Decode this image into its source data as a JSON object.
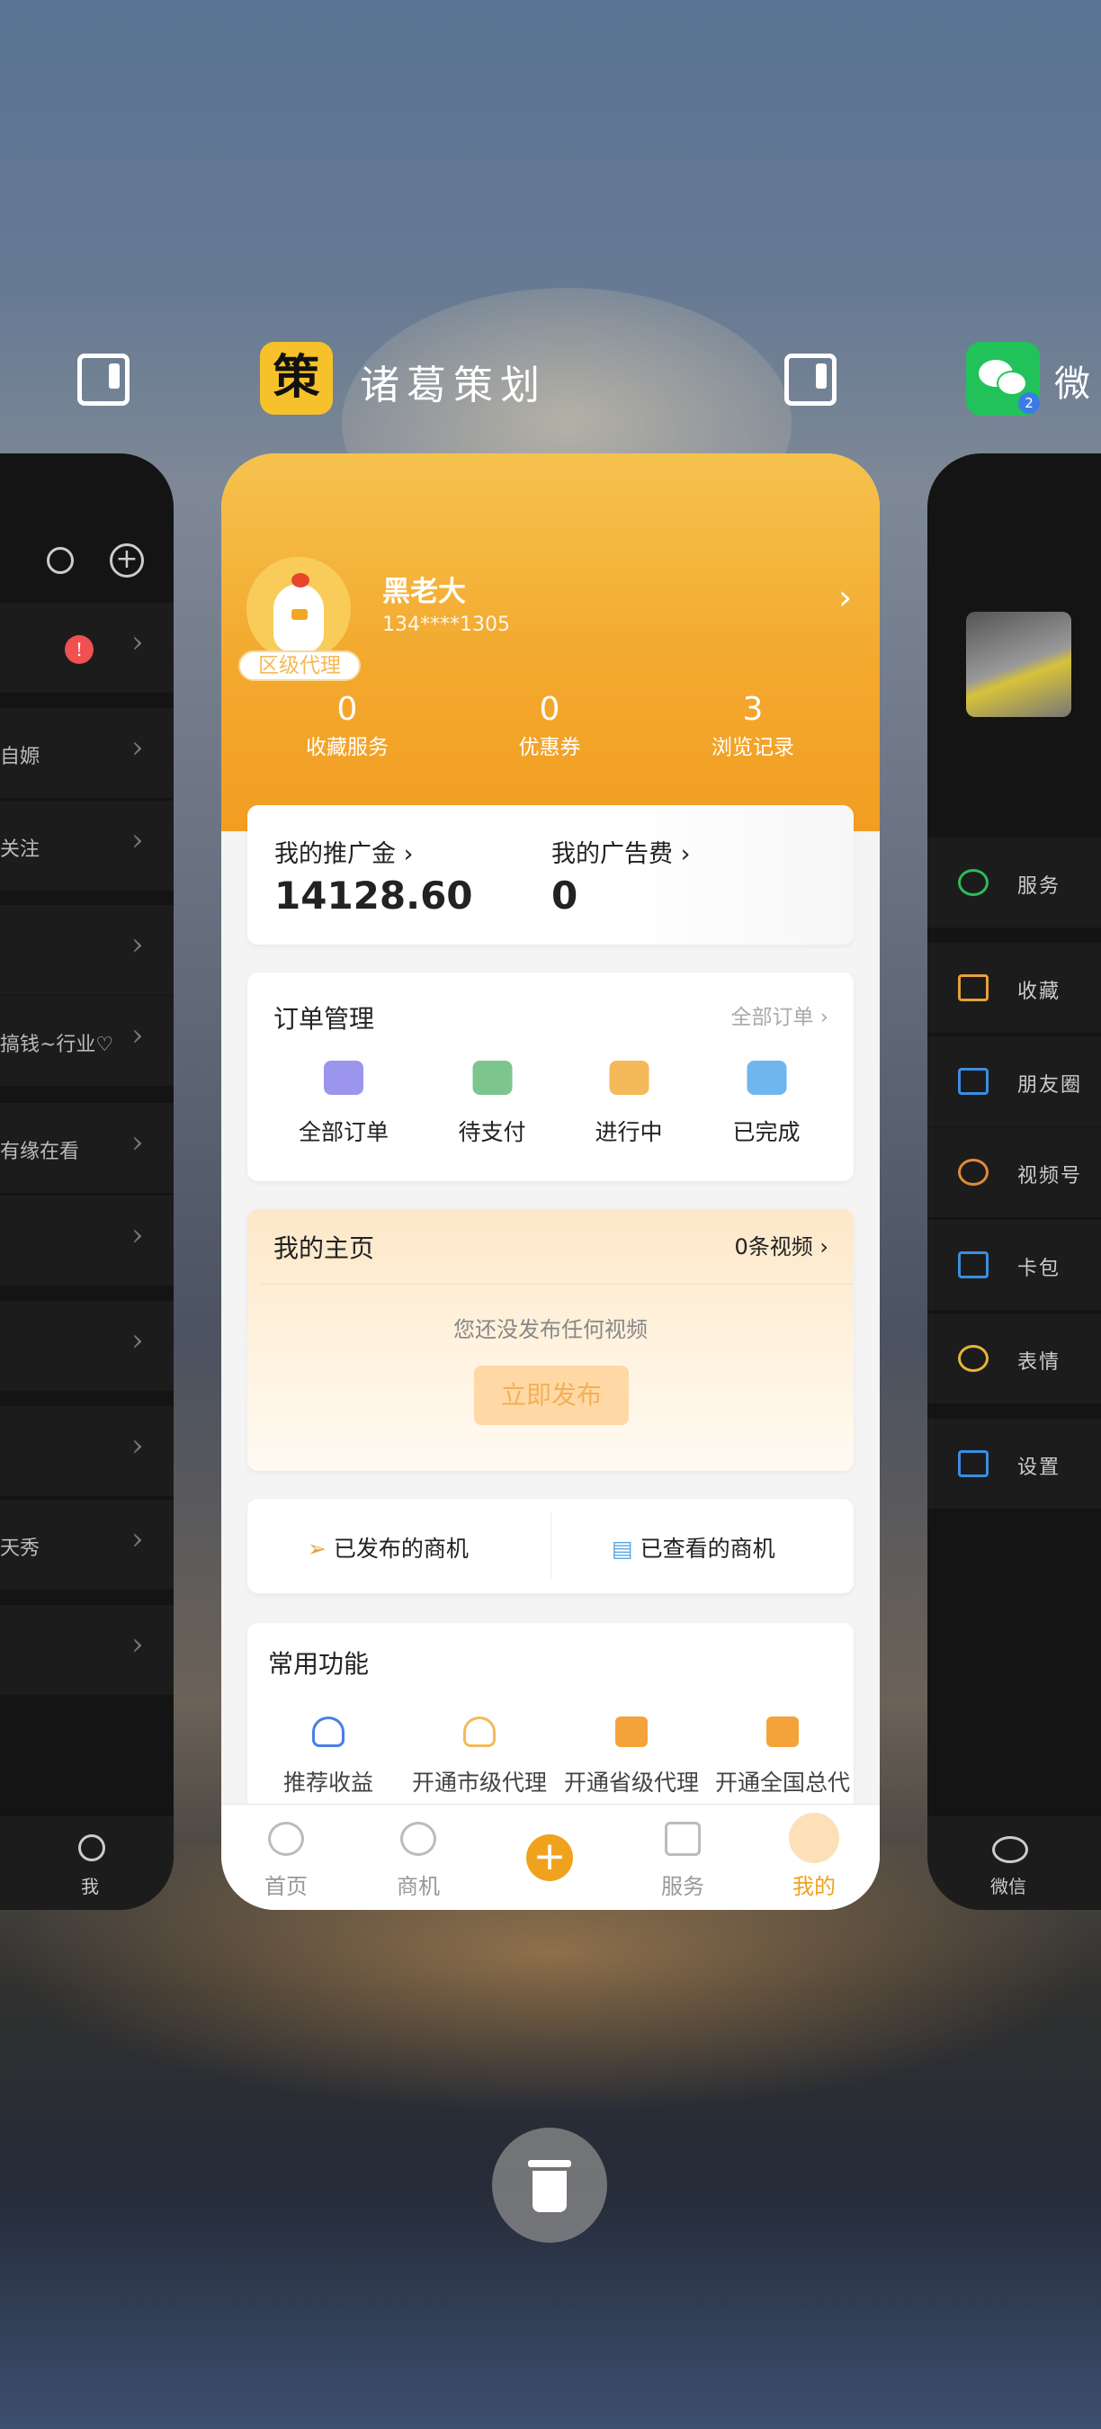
{
  "switcher": {
    "center_app_title": "诸葛策划",
    "center_app_icon_text": "策",
    "right_app_title_partial": "微",
    "right_app_badge": "2"
  },
  "left_app": {
    "rows": [
      {
        "text": "",
        "badge": "!"
      },
      {
        "text": "自嫄"
      },
      {
        "text": "关注"
      },
      {
        "text": ""
      },
      {
        "text": "搞钱~行业♡"
      },
      {
        "text": "有缘在看"
      },
      {
        "text": ""
      },
      {
        "text": ""
      },
      {
        "text": ""
      },
      {
        "text": "天秀"
      },
      {
        "text": ""
      }
    ],
    "tab_label": "我"
  },
  "right_app": {
    "menu": [
      {
        "icon": "service-icon",
        "label": "服务",
        "color": "#2dbb5a"
      },
      {
        "icon": "favorites-cube-icon",
        "label": "收藏",
        "color": "#e5a13a"
      },
      {
        "icon": "moments-image-icon",
        "label": "朋友圈",
        "color": "#3b8ee0"
      },
      {
        "icon": "channels-play-icon",
        "label": "视频号",
        "color": "#e08a3b"
      },
      {
        "icon": "card-wallet-icon",
        "label": "卡包",
        "color": "#3b8ee0"
      },
      {
        "icon": "sticker-smile-icon",
        "label": "表情",
        "color": "#e5b53a"
      },
      {
        "icon": "settings-gear-icon",
        "label": "设置",
        "color": "#3b8ee0"
      }
    ],
    "tab_label": "微信"
  },
  "profile": {
    "name": "黑老大",
    "phone": "134****1305",
    "level_badge": "区级代理",
    "stats": [
      {
        "value": "0",
        "label": "收藏服务"
      },
      {
        "value": "0",
        "label": "优惠券"
      },
      {
        "value": "3",
        "label": "浏览记录"
      }
    ]
  },
  "wallet": {
    "promo_label": "我的推广金",
    "promo_value": "14128.60",
    "ad_label": "我的广告费",
    "ad_value": "0"
  },
  "orders": {
    "title": "订单管理",
    "all_link": "全部订单",
    "items": [
      {
        "label": "全部订单",
        "icon": "wallet-icon",
        "color": "#9b95ee"
      },
      {
        "label": "待支付",
        "icon": "package-icon",
        "color": "#7cc58e"
      },
      {
        "label": "进行中",
        "icon": "delivery-truck-icon",
        "color": "#f4b95a"
      },
      {
        "label": "已完成",
        "icon": "chat-smile-icon",
        "color": "#6fb6ee"
      }
    ]
  },
  "homepage": {
    "title": "我的主页",
    "video_count": "0条视频",
    "empty_text": "您还没发布任何视频",
    "publish_button": "立即发布"
  },
  "business": {
    "published": "已发布的商机",
    "viewed": "已查看的商机"
  },
  "functions": {
    "title": "常用功能",
    "items": [
      {
        "label": "推荐收益"
      },
      {
        "label": "开通市级代理"
      },
      {
        "label": "开通省级代理"
      },
      {
        "label": "开通全国总代"
      }
    ]
  },
  "tabbar": {
    "items": [
      {
        "label": "首页",
        "icon": "home-icon"
      },
      {
        "label": "商机",
        "icon": "planet-icon"
      },
      {
        "label": "",
        "icon": "plus-icon"
      },
      {
        "label": "服务",
        "icon": "grid-icon"
      },
      {
        "label": "我的",
        "icon": "profile-icon",
        "active": true
      }
    ],
    "accent": "#f0a21f"
  }
}
